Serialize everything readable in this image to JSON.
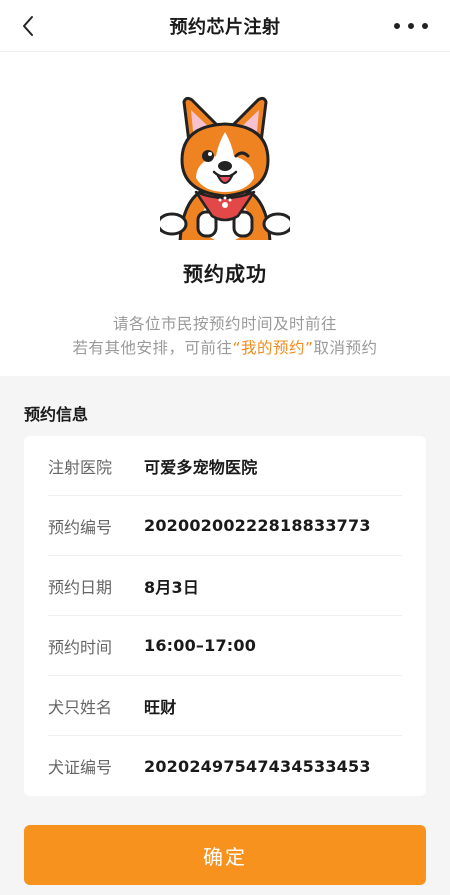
{
  "header": {
    "title": "预约芯片注射",
    "back_icon": "chevron-left-icon",
    "more_icon": "more-dots-icon"
  },
  "hero": {
    "illustration": "corgi-dog-illustration",
    "title": "预约成功",
    "desc_line1": "请各位市民按预约时间及时前往",
    "desc_line2_prefix": "若有其他安排，可前往",
    "desc_line2_link": "“我的预约”",
    "desc_line2_suffix": "取消预约"
  },
  "section": {
    "title": "预约信息"
  },
  "info": {
    "rows": [
      {
        "label": "注射医院",
        "value": "可爱多宠物医院"
      },
      {
        "label": "预约编号",
        "value": "20200200222818833773"
      },
      {
        "label": "预约日期",
        "value": "8月3日"
      },
      {
        "label": "预约时间",
        "value": "16:00–17:00"
      },
      {
        "label": "犬只姓名",
        "value": "旺财"
      },
      {
        "label": "犬证编号",
        "value": "20202497547434533453"
      }
    ]
  },
  "footer": {
    "confirm_label": "确定"
  },
  "colors": {
    "accent": "#f7921e",
    "link": "#f18c1f",
    "background": "#f5f5f5"
  }
}
